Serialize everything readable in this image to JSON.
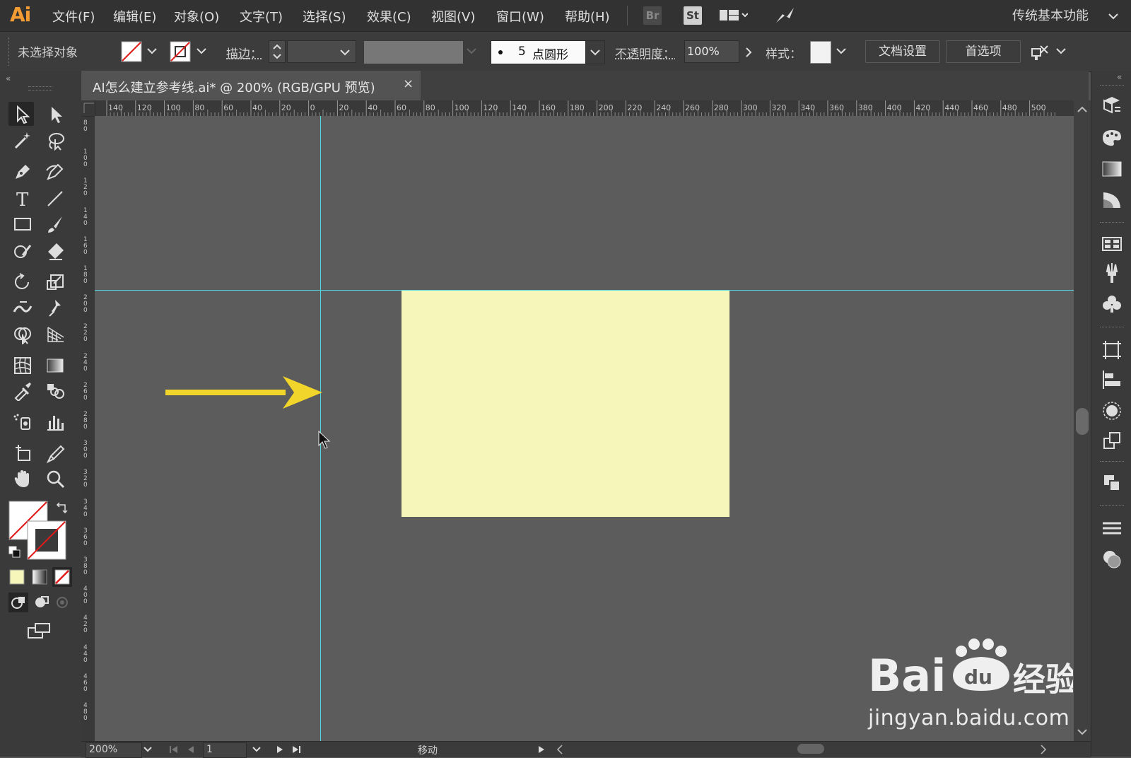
{
  "app": {
    "logo": "Ai"
  },
  "menubar": {
    "items": [
      "文件(F)",
      "编辑(E)",
      "对象(O)",
      "文字(T)",
      "选择(S)",
      "效果(C)",
      "视图(V)",
      "窗口(W)",
      "帮助(H)"
    ],
    "bridge_label": "Br",
    "stock_label": "St",
    "workspace": "传统基本功能"
  },
  "controlbar": {
    "selection_status": "未选择对象",
    "stroke_label": "描边：",
    "brush_size": "5",
    "brush_shape": "点圆形",
    "opacity_label": "不透明度：",
    "opacity_value": "100%",
    "style_label": "样式：",
    "doc_setup_button": "文档设置",
    "preferences_button": "首选项"
  },
  "tab": {
    "title": "AI怎么建立参考线.ai* @ 200% (RGB/GPU 预览)",
    "close": "×"
  },
  "rulers": {
    "horizontal_ticks": [
      "140",
      "120",
      "100",
      "80",
      "60",
      "40",
      "20",
      "0",
      "20",
      "40",
      "60",
      "80",
      "100",
      "120",
      "140",
      "160",
      "180",
      "200",
      "220",
      "240",
      "260",
      "280",
      "300",
      "320",
      "340",
      "360",
      "380",
      "400",
      "420",
      "440",
      "460",
      "480",
      "500"
    ],
    "vertical_ticks": [
      "80",
      "100",
      "120",
      "140",
      "160",
      "180",
      "200",
      "220",
      "240",
      "260",
      "280",
      "300",
      "320",
      "340",
      "360",
      "380",
      "400",
      "420",
      "440",
      "460",
      "480"
    ]
  },
  "statusbar": {
    "zoom": "200%",
    "artboard": "1",
    "tool_status": "移动"
  },
  "watermark": {
    "logo_text": "Bai经验",
    "url": "jingyan.baidu.com"
  },
  "colors": {
    "rectangle_fill": "#f6f6bb",
    "guide": "#55d6e0",
    "arrow": "#f2d52a",
    "menu_bg": "#323232",
    "canvas_bg": "#5c5c5c"
  }
}
